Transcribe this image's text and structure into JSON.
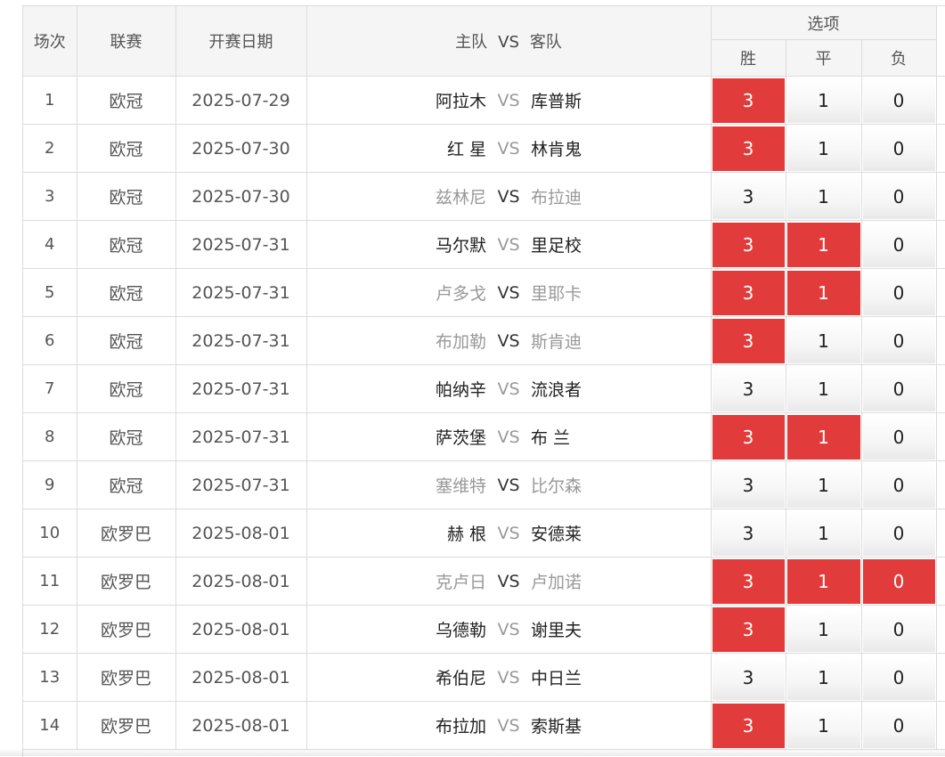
{
  "header": {
    "index": "场次",
    "league": "联赛",
    "date": "开赛日期",
    "home": "主队",
    "vs": "VS",
    "away": "客队",
    "options": "选项",
    "win": "胜",
    "draw": "平",
    "lose": "负"
  },
  "colors": {
    "selected": "#e23b3b",
    "border": "#dcdcdc",
    "header_bg": "#f5f5f5"
  },
  "rows": [
    {
      "idx": "1",
      "league": "欧冠",
      "date": "2025-07-29",
      "home": "阿拉木",
      "vs": "VS",
      "away": "库普斯",
      "home_grey": false,
      "away_grey": false,
      "vs_active": false,
      "win": "3",
      "draw": "1",
      "lose": "0",
      "win_on": true,
      "draw_on": false,
      "lose_on": false
    },
    {
      "idx": "2",
      "league": "欧冠",
      "date": "2025-07-30",
      "home": "红 星",
      "vs": "VS",
      "away": "林肯鬼",
      "home_grey": false,
      "away_grey": false,
      "vs_active": false,
      "win": "3",
      "draw": "1",
      "lose": "0",
      "win_on": true,
      "draw_on": false,
      "lose_on": false
    },
    {
      "idx": "3",
      "league": "欧冠",
      "date": "2025-07-30",
      "home": "兹林尼",
      "vs": "VS",
      "away": "布拉迪",
      "home_grey": true,
      "away_grey": true,
      "vs_active": true,
      "win": "3",
      "draw": "1",
      "lose": "0",
      "win_on": false,
      "draw_on": false,
      "lose_on": false
    },
    {
      "idx": "4",
      "league": "欧冠",
      "date": "2025-07-31",
      "home": "马尔默",
      "vs": "VS",
      "away": "里足校",
      "home_grey": false,
      "away_grey": false,
      "vs_active": false,
      "win": "3",
      "draw": "1",
      "lose": "0",
      "win_on": true,
      "draw_on": true,
      "lose_on": false
    },
    {
      "idx": "5",
      "league": "欧冠",
      "date": "2025-07-31",
      "home": "卢多戈",
      "vs": "VS",
      "away": "里耶卡",
      "home_grey": true,
      "away_grey": true,
      "vs_active": true,
      "win": "3",
      "draw": "1",
      "lose": "0",
      "win_on": true,
      "draw_on": true,
      "lose_on": false
    },
    {
      "idx": "6",
      "league": "欧冠",
      "date": "2025-07-31",
      "home": "布加勒",
      "vs": "VS",
      "away": "斯肯迪",
      "home_grey": true,
      "away_grey": true,
      "vs_active": true,
      "win": "3",
      "draw": "1",
      "lose": "0",
      "win_on": true,
      "draw_on": false,
      "lose_on": false
    },
    {
      "idx": "7",
      "league": "欧冠",
      "date": "2025-07-31",
      "home": "帕纳辛",
      "vs": "VS",
      "away": "流浪者",
      "home_grey": false,
      "away_grey": false,
      "vs_active": false,
      "win": "3",
      "draw": "1",
      "lose": "0",
      "win_on": false,
      "draw_on": false,
      "lose_on": false
    },
    {
      "idx": "8",
      "league": "欧冠",
      "date": "2025-07-31",
      "home": "萨茨堡",
      "vs": "VS",
      "away": "布 兰",
      "home_grey": false,
      "away_grey": false,
      "vs_active": false,
      "win": "3",
      "draw": "1",
      "lose": "0",
      "win_on": true,
      "draw_on": true,
      "lose_on": false
    },
    {
      "idx": "9",
      "league": "欧冠",
      "date": "2025-07-31",
      "home": "塞维特",
      "vs": "VS",
      "away": "比尔森",
      "home_grey": true,
      "away_grey": true,
      "vs_active": true,
      "win": "3",
      "draw": "1",
      "lose": "0",
      "win_on": false,
      "draw_on": false,
      "lose_on": false
    },
    {
      "idx": "10",
      "league": "欧罗巴",
      "date": "2025-08-01",
      "home": "赫 根",
      "vs": "VS",
      "away": "安德莱",
      "home_grey": false,
      "away_grey": false,
      "vs_active": false,
      "win": "3",
      "draw": "1",
      "lose": "0",
      "win_on": false,
      "draw_on": false,
      "lose_on": false
    },
    {
      "idx": "11",
      "league": "欧罗巴",
      "date": "2025-08-01",
      "home": "克卢日",
      "vs": "VS",
      "away": "卢加诺",
      "home_grey": true,
      "away_grey": true,
      "vs_active": true,
      "win": "3",
      "draw": "1",
      "lose": "0",
      "win_on": true,
      "draw_on": true,
      "lose_on": true
    },
    {
      "idx": "12",
      "league": "欧罗巴",
      "date": "2025-08-01",
      "home": "乌德勒",
      "vs": "VS",
      "away": "谢里夫",
      "home_grey": false,
      "away_grey": false,
      "vs_active": false,
      "win": "3",
      "draw": "1",
      "lose": "0",
      "win_on": true,
      "draw_on": false,
      "lose_on": false
    },
    {
      "idx": "13",
      "league": "欧罗巴",
      "date": "2025-08-01",
      "home": "希伯尼",
      "vs": "VS",
      "away": "中日兰",
      "home_grey": false,
      "away_grey": false,
      "vs_active": false,
      "win": "3",
      "draw": "1",
      "lose": "0",
      "win_on": false,
      "draw_on": false,
      "lose_on": false
    },
    {
      "idx": "14",
      "league": "欧罗巴",
      "date": "2025-08-01",
      "home": "布拉加",
      "vs": "VS",
      "away": "索斯基",
      "home_grey": false,
      "away_grey": false,
      "vs_active": false,
      "win": "3",
      "draw": "1",
      "lose": "0",
      "win_on": true,
      "draw_on": false,
      "lose_on": false
    }
  ]
}
